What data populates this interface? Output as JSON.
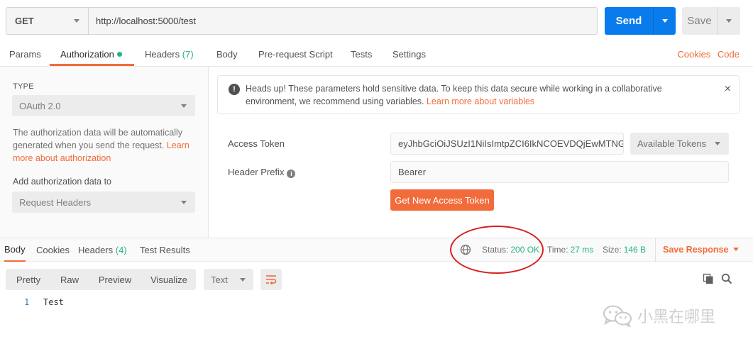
{
  "request": {
    "method": "GET",
    "url": "http://localhost:5000/test",
    "send_label": "Send",
    "save_label": "Save"
  },
  "tabs": {
    "params": "Params",
    "authorization": "Authorization",
    "headers": "Headers",
    "headers_count": "(7)",
    "body": "Body",
    "prerequest": "Pre-request Script",
    "tests": "Tests",
    "settings": "Settings",
    "cookies": "Cookies",
    "code": "Code"
  },
  "auth": {
    "type_label": "TYPE",
    "type_value": "OAuth 2.0",
    "description": "The authorization data will be automatically generated when you send the request. ",
    "learn_more": "Learn more about authorization",
    "add_to_label": "Add authorization data to",
    "add_to_value": "Request Headers"
  },
  "alert": {
    "text": "Heads up! These parameters hold sensitive data. To keep this data secure while working in a collaborative environment, we recommend using variables. ",
    "link": "Learn more about variables",
    "close": "×"
  },
  "token": {
    "access_token_label": "Access Token",
    "access_token_value": "eyJhbGciOiJSUzI1NiIsImtpZCI6IkNCOEVDQjEwMTNGQ",
    "available_tokens": "Available Tokens",
    "header_prefix_label": "Header Prefix",
    "header_prefix_value": "Bearer",
    "get_new_token": "Get New Access Token"
  },
  "response": {
    "tabs": {
      "body": "Body",
      "cookies": "Cookies",
      "headers": "Headers",
      "headers_count": "(4)",
      "test_results": "Test Results"
    },
    "status_label": "Status:",
    "status_value": "200 OK",
    "time_label": "Time:",
    "time_value": "27 ms",
    "size_label": "Size:",
    "size_value": "146 B",
    "save_response": "Save Response",
    "views": [
      "Pretty",
      "Raw",
      "Preview",
      "Visualize"
    ],
    "language": "Text",
    "line_number": "1",
    "line_text": "Test"
  },
  "watermark": "小黑在哪里",
  "colors": {
    "accent": "#f26b3a",
    "primary": "#097bed",
    "success": "#26b47f",
    "annotation": "#d91f1f"
  },
  "icons": [
    "caret-down-icon",
    "info-icon",
    "close-icon",
    "globe-icon",
    "copy-icon",
    "search-icon",
    "wrap-lines-icon",
    "wechat-icon"
  ]
}
